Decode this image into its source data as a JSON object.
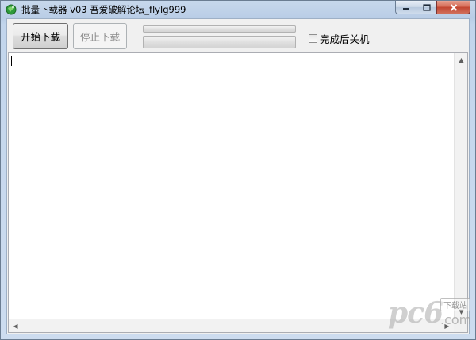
{
  "window": {
    "title": "批量下载器  v03  吾爱破解论坛_flylg999",
    "caption_buttons": {
      "minimize_icon": "minimize-icon",
      "maximize_icon": "maximize-icon",
      "close_icon": "close-icon"
    },
    "app_icon": "green-globe-icon"
  },
  "toolbar": {
    "start_label": "开始下载",
    "stop_label": "停止下载",
    "stop_enabled": false,
    "progress_top": 0,
    "progress_bottom": 0,
    "shutdown_label": "完成后关机",
    "shutdown_checked": false
  },
  "log": {
    "text": ""
  },
  "watermark": {
    "logo": "pc6",
    "badge": "下载站",
    "domain": ".com"
  },
  "colors": {
    "title_bar": "#c2d5ec",
    "client_bg": "#f0f0f0",
    "close_button": "#c24530",
    "progress_fill": "#3cb043"
  }
}
